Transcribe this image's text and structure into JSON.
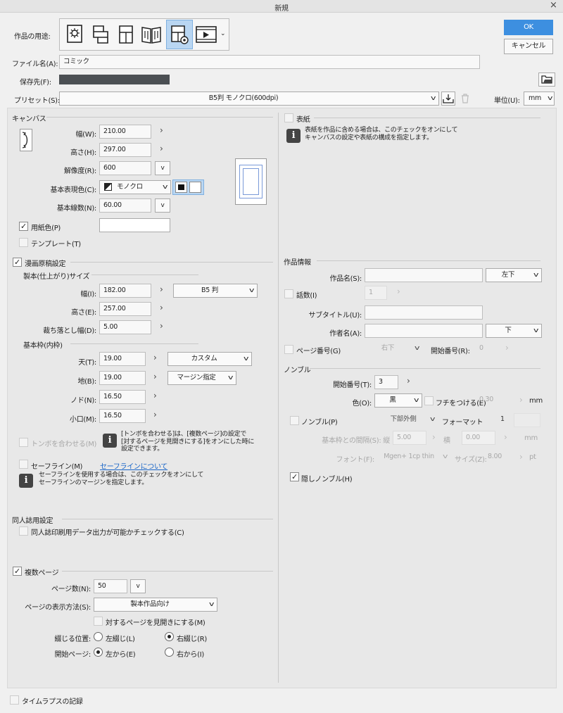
{
  "window": {
    "title": "新規",
    "close": "×"
  },
  "header": {
    "usage_label": "作品の用途:",
    "ok_label": "OK",
    "cancel_label": "キャンセル",
    "filename_label": "ファイル名(A):",
    "filename_value": "コミック",
    "savepath_label": "保存先(F):",
    "preset_label": "プリセット(S):",
    "preset_value": "B5判 モノクロ(600dpi)",
    "unit_label": "単位(U):",
    "unit_value": "mm"
  },
  "usage_icons": [
    "illustration-icon",
    "webtoon-icon",
    "comic-icon",
    "book-icon",
    "show-all-settings-icon",
    "animation-icon"
  ],
  "canvas": {
    "section": "キャンバス",
    "width_label": "幅(W):",
    "width_value": "210.00",
    "height_label": "高さ(H):",
    "height_value": "297.00",
    "res_label": "解像度(R):",
    "res_value": "600",
    "color_label": "基本表現色(C):",
    "color_value": "モノクロ",
    "line_label": "基本線数(N):",
    "line_value": "60.00",
    "paper_label": "用紙色(P)",
    "paper_color": "#ffffff",
    "template_label": "テンプレート(T)"
  },
  "manga": {
    "section": "漫画原稿設定",
    "trim_section": "製本(仕上がり)サイズ",
    "trim_width_label": "幅(I):",
    "trim_width_value": "182.00",
    "trim_size_value": "B5 判",
    "trim_height_label": "高さ(E):",
    "trim_height_value": "257.00",
    "bleed_label": "裁ち落とし幅(D):",
    "bleed_value": "5.00",
    "frame_section": "基本枠(内枠)",
    "top_label": "天(T):",
    "top_value": "19.00",
    "top_sel": "カスタム",
    "bottom_label": "地(B):",
    "bottom_value": "19.00",
    "bottom_sel": "マージン指定",
    "gutter_label": "ノド(N):",
    "gutter_value": "16.50",
    "fore_label": "小口(M):",
    "fore_value": "16.50",
    "crop_label": "トンボを合わせる(M)",
    "crop_note": "[トンボを合わせる]は、[複数ページ]の設定で\n[対するページを見開きにする]をオンにした時に\n設定できます。",
    "safe_label": "セーフライン(M)",
    "safe_link": "セーフラインについて",
    "safe_note": "セーフラインを使用する場合は、このチェックをオンにして\nセーフラインのマージンを指定します。"
  },
  "doujin": {
    "section": "同人誌用設定",
    "check_label": "同人誌印刷用データ出力が可能かチェックする(C)"
  },
  "multi": {
    "section": "複数ページ",
    "pages_label": "ページ数(N):",
    "pages_value": "50",
    "display_label": "ページの表示方法(S):",
    "display_value": "製本作品向け",
    "spread_label": "対するページを見開きにする(M)",
    "binding_label": "綴じる位置:",
    "left_bind": "左綴じ(L)",
    "right_bind": "右綴じ(R)",
    "start_label": "開始ページ:",
    "start_left": "左から(E)",
    "start_right": "右から(I)"
  },
  "cover": {
    "label": "表紙",
    "note": "表紙を作品に含める場合は、このチェックをオンにして\nキャンバスの設定や表紙の構成を指定します。"
  },
  "work": {
    "section": "作品情報",
    "name_label": "作品名(S):",
    "name_pos": "左下",
    "episode_label": "話数(I)",
    "episode_value": "1",
    "subtitle_label": "サブタイトル(U):",
    "author_label": "作者名(A):",
    "author_pos": "下",
    "pagenum_label": "ページ番号(G)",
    "pagenum_pos": "右下",
    "startnum_label": "開始番号(R):",
    "startnum_value": "0"
  },
  "nombre": {
    "section": "ノンブル",
    "start_label": "開始番号(T):",
    "start_value": "3",
    "color_label": "色(O):",
    "color_value": "黒",
    "edge_label": "フチをつける(E)",
    "edge_value": "0.30",
    "unit": "mm",
    "nombre_label": "ノンブル(P)",
    "nombre_pos": "下部外側",
    "format_label": "フォーマット",
    "format_value": "1",
    "gap_label": "基本枠との間隔(S):",
    "vert_label": "縦",
    "vert_value": "5.00",
    "horiz_label": "横",
    "horiz_value": "0.00",
    "font_label": "フォント(F):",
    "font_value": "Mgen+ 1cp thin",
    "size_label": "サイズ(Z):",
    "size_value": "8.00",
    "size_unit": "pt",
    "hidden_label": "隠しノンブル(H)"
  },
  "footer": {
    "timelapse_label": "タイムラプスの記録"
  }
}
